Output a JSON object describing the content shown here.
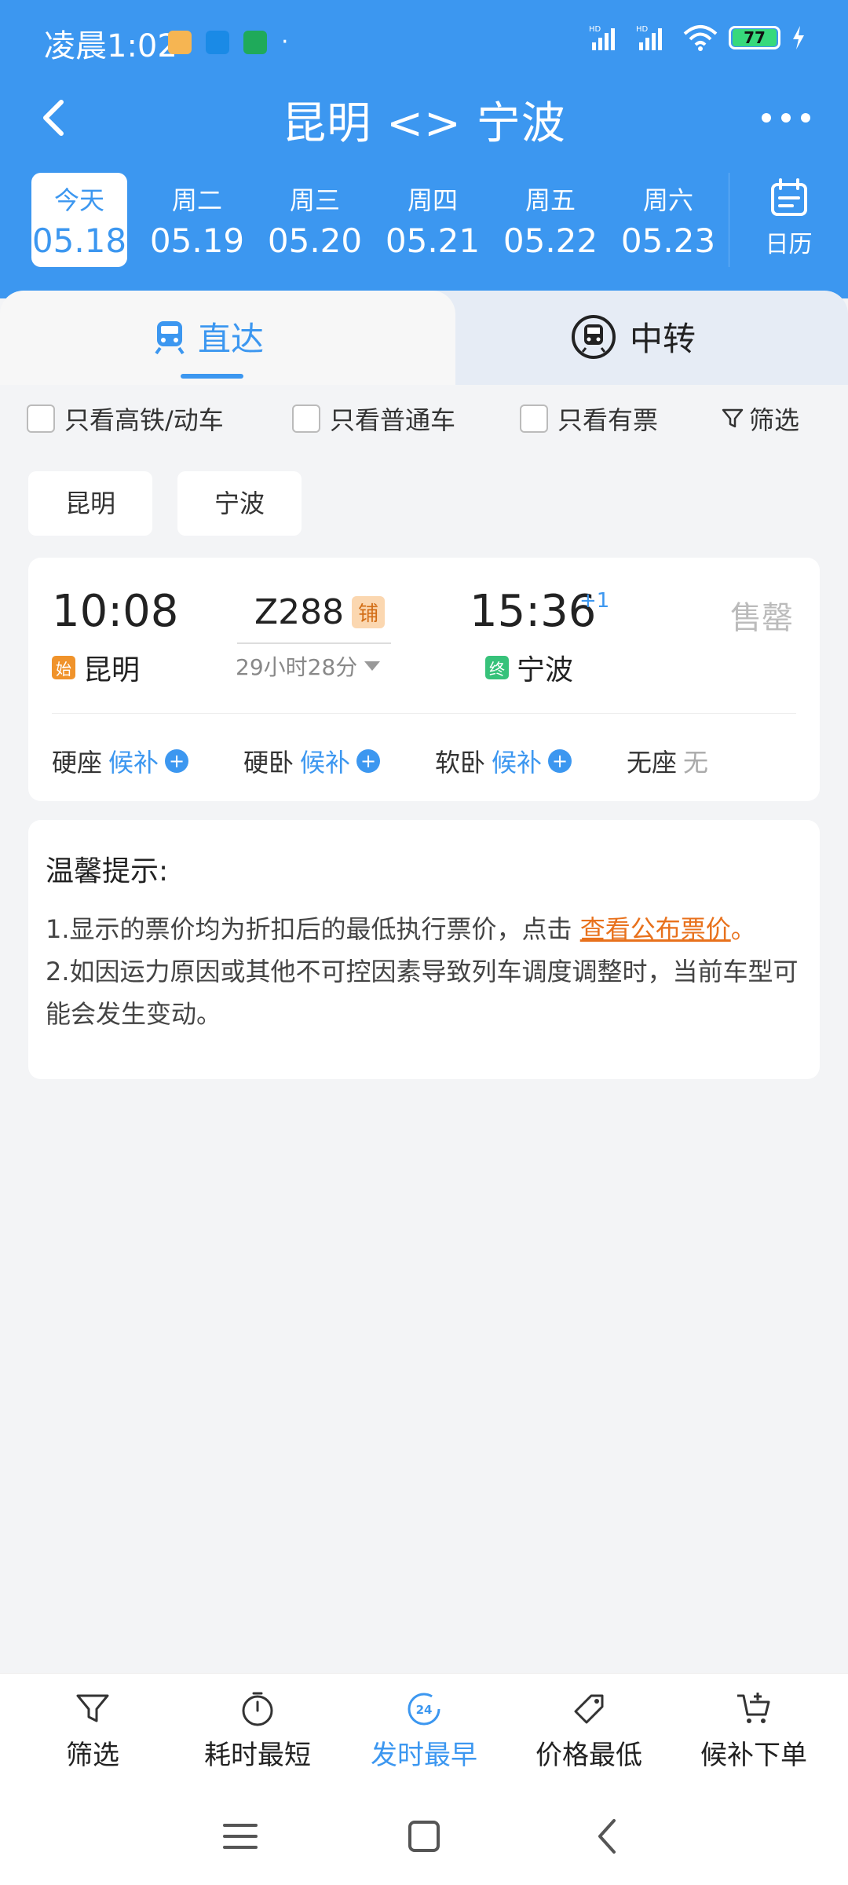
{
  "status_bar": {
    "time": "凌晨1:02",
    "battery": "77"
  },
  "nav": {
    "title": "昆明 <> 宁波"
  },
  "date_tabs": [
    {
      "week": "今天",
      "date": "05.18",
      "active": true
    },
    {
      "week": "周二",
      "date": "05.19",
      "active": false
    },
    {
      "week": "周三",
      "date": "05.20",
      "active": false
    },
    {
      "week": "周四",
      "date": "05.21",
      "active": false
    },
    {
      "week": "周五",
      "date": "05.22",
      "active": false
    },
    {
      "week": "周六",
      "date": "05.23",
      "active": false
    }
  ],
  "calendar_label": "日历",
  "mode_tabs": {
    "direct": "直达",
    "transfer": "中转"
  },
  "filters": {
    "high_speed": "只看高铁/动车",
    "normal": "只看普通车",
    "available": "只看有票",
    "filter": "筛选"
  },
  "stations": [
    "昆明",
    "宁波"
  ],
  "train": {
    "depart_time": "10:08",
    "arrive_time": "15:36",
    "plus_day": "+1",
    "number": "Z288",
    "berth_badge": "铺",
    "duration": "29小时28分",
    "status": "售罄",
    "from_tag": "始",
    "from": "昆明",
    "to_tag": "终",
    "to": "宁波",
    "seats": [
      {
        "type": "硬座",
        "status": "候补",
        "plus": true
      },
      {
        "type": "硬卧",
        "status": "候补",
        "plus": true
      },
      {
        "type": "软卧",
        "status": "候补",
        "plus": true
      },
      {
        "type": "无座",
        "status": "无",
        "plus": false
      }
    ]
  },
  "tips": {
    "title": "温馨提示:",
    "line1": "1.显示的票价均为折扣后的最低执行票价，点击",
    "line1_link": "查看公布票价",
    "line1_end": "。",
    "line2": "2.如因运力原因或其他不可控因素导致列车调度调整时，当前车型可能会发生变动。"
  },
  "bottom_bar": [
    {
      "label": "筛选",
      "icon": "funnel-icon",
      "active": false
    },
    {
      "label": "耗时最短",
      "icon": "timer-icon",
      "active": false
    },
    {
      "label": "发时最早",
      "icon": "clock-24-icon",
      "active": true
    },
    {
      "label": "价格最低",
      "icon": "price-tag-icon",
      "active": false
    },
    {
      "label": "候补下单",
      "icon": "cart-plus-icon",
      "active": false
    }
  ],
  "colors": {
    "primary": "#3c97f0",
    "orange": "#e8711c",
    "green_tag": "#37c27a",
    "orange_tag": "#f0932b"
  }
}
